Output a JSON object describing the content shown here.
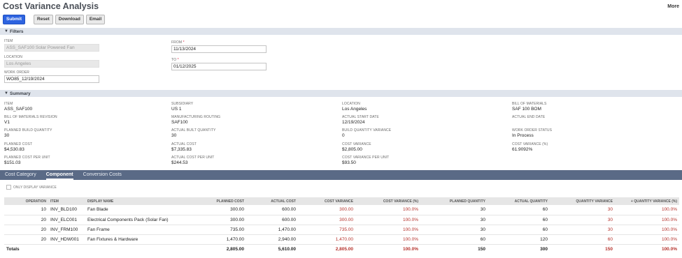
{
  "page": {
    "title": "Cost Variance Analysis",
    "more": "More"
  },
  "toolbar": {
    "submit": "Submit",
    "reset": "Reset",
    "download": "Download",
    "email": "Email"
  },
  "filters": {
    "header": "Filters",
    "item": {
      "label": "ITEM",
      "value": "ASS_SAF100 Solar Powered Fan"
    },
    "location": {
      "label": "LOCATION",
      "value": "Los Angeles"
    },
    "work_order": {
      "label": "WORK ORDER",
      "value": "WO85_12/19/2024"
    },
    "from": {
      "label": "FROM",
      "required": "*",
      "value": "11/13/2024"
    },
    "to": {
      "label": "TO",
      "required": "*",
      "value": "01/12/2025"
    }
  },
  "summary": {
    "header": "Summary",
    "fields": [
      {
        "label": "ITEM",
        "value": "ASS_SAF100"
      },
      {
        "label": "SUBSIDIARY",
        "value": "US 1"
      },
      {
        "label": "LOCATION",
        "value": "Los Angeles"
      },
      {
        "label": "BILL OF MATERIALS",
        "value": "SAF 100 BOM"
      },
      {
        "label": "BILL OF MATERIALS REVISION",
        "value": "V1"
      },
      {
        "label": "MANUFACTURING ROUTING",
        "value": "SAF100"
      },
      {
        "label": "ACTUAL START DATE",
        "value": "12/19/2024"
      },
      {
        "label": "ACTUAL END DATE",
        "value": ""
      },
      {
        "label": "PLANNED BUILD QUANTITY",
        "value": "30"
      },
      {
        "label": "ACTUAL BUILT QUANTITY",
        "value": "30"
      },
      {
        "label": "BUILD QUANTITY VARIANCE",
        "value": "0"
      },
      {
        "label": "WORK ORDER STATUS",
        "value": "In Process"
      },
      {
        "label": "PLANNED COST",
        "value": "$4,530.83"
      },
      {
        "label": "ACTUAL COST",
        "value": "$7,335.83"
      },
      {
        "label": "COST VARIANCE",
        "value": "$2,805.00"
      },
      {
        "label": "COST VARIANCE (%)",
        "value": "61.9092%"
      },
      {
        "label": "PLANNED COST PER UNIT",
        "value": "$151.03"
      },
      {
        "label": "ACTUAL COST PER UNIT",
        "value": "$244.53"
      },
      {
        "label": "COST VARIANCE PER UNIT",
        "value": "$93.50"
      }
    ]
  },
  "tabs": [
    {
      "label": "Cost Category",
      "active": false
    },
    {
      "label": "Component",
      "active": true
    },
    {
      "label": "Conversion Costs",
      "active": false
    }
  ],
  "only_display_variance": "ONLY DISPLAY VARIANCE",
  "table": {
    "columns": [
      "OPERATION",
      "ITEM",
      "DISPLAY NAME",
      "PLANNED COST",
      "ACTUAL COST",
      "COST VARIANCE",
      "COST VARIANCE (%)",
      "PLANNED QUANTITY",
      "ACTUAL QUANTITY",
      "QUANTITY VARIANCE",
      "+ QUANTITY VARIANCE (%)"
    ],
    "rows": [
      [
        "10",
        "INV_BLD100",
        "Fan Blade",
        "300.00",
        "600.00",
        "300.00",
        "100.0%",
        "30",
        "60",
        "30",
        "100.0%"
      ],
      [
        "20",
        "INV_ELC001",
        "Electrical Components Pack (Solar Fan)",
        "300.00",
        "600.00",
        "300.00",
        "100.0%",
        "30",
        "60",
        "30",
        "100.0%"
      ],
      [
        "20",
        "INV_FRM100",
        "Fan Frame",
        "735.00",
        "1,470.00",
        "735.00",
        "100.0%",
        "30",
        "60",
        "30",
        "100.0%"
      ],
      [
        "20",
        "INV_HDW001",
        "Fan Fixtures & Hardware",
        "1,470.00",
        "2,940.00",
        "1,470.00",
        "100.0%",
        "60",
        "120",
        "60",
        "100.0%"
      ]
    ],
    "totals": [
      "Totals",
      "",
      "",
      "2,805.00",
      "5,610.00",
      "2,805.00",
      "100.0%",
      "150",
      "300",
      "150",
      "100.0%"
    ]
  },
  "colors": {
    "primary_button": "#2d63e0",
    "tab_bar": "#5a6a86",
    "section_bar": "#dfe4ec",
    "variance_red": "#b5312b"
  }
}
